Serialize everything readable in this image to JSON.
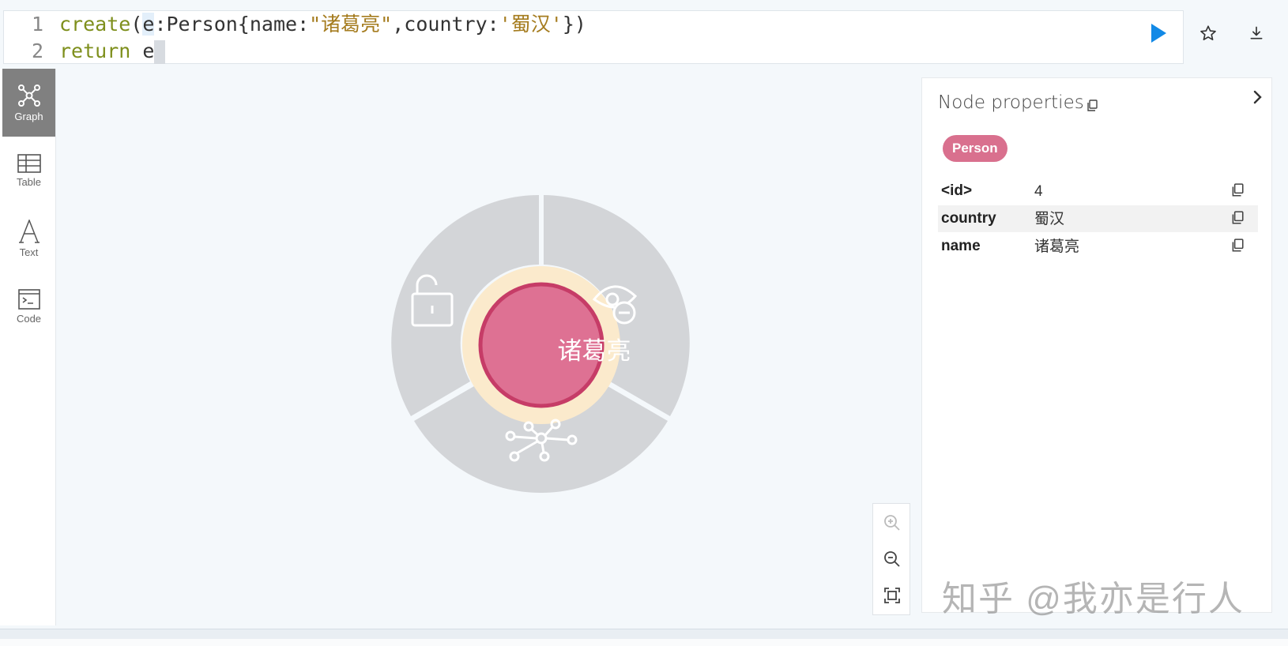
{
  "editor": {
    "lines": [
      {
        "number": "1",
        "keyword": "create",
        "paren_open": "(",
        "var": "e",
        "colon_label": ":Person",
        "brace_open": "{",
        "key1": "name:",
        "val1": "\"诸葛亮\"",
        "comma": ",",
        "key2": "country:",
        "val2": "'蜀汉'",
        "brace_close": "})"
      },
      {
        "number": "2",
        "keyword": "return",
        "var": "e"
      }
    ],
    "run_icon": "play-icon",
    "favorite_icon": "star-icon",
    "download_icon": "download-icon"
  },
  "sidebar": {
    "items": [
      {
        "label": "Graph",
        "icon": "graph-icon",
        "active": true
      },
      {
        "label": "Table",
        "icon": "table-icon",
        "active": false
      },
      {
        "label": "Text",
        "icon": "text-icon",
        "active": false
      },
      {
        "label": "Code",
        "icon": "code-icon",
        "active": false
      }
    ]
  },
  "graph": {
    "node_label": "诸葛亮",
    "node_color": "#de7193",
    "node_border_color": "#c63c67",
    "halo_color": "#fbeacc",
    "ring_color": "#d3d5d8",
    "ring_actions": [
      "unlock-icon",
      "hide-icon",
      "expand-icon"
    ]
  },
  "zoom": {
    "zoom_in_icon": "zoom-in-icon",
    "zoom_out_icon": "zoom-out-icon",
    "fit_icon": "fit-icon"
  },
  "panel": {
    "title": "Node properties",
    "label_chip": "Person",
    "properties": [
      {
        "key": "<id>",
        "value": "4"
      },
      {
        "key": "country",
        "value": "蜀汉"
      },
      {
        "key": "name",
        "value": "诸葛亮"
      }
    ]
  },
  "watermark": "知乎 @我亦是行人"
}
